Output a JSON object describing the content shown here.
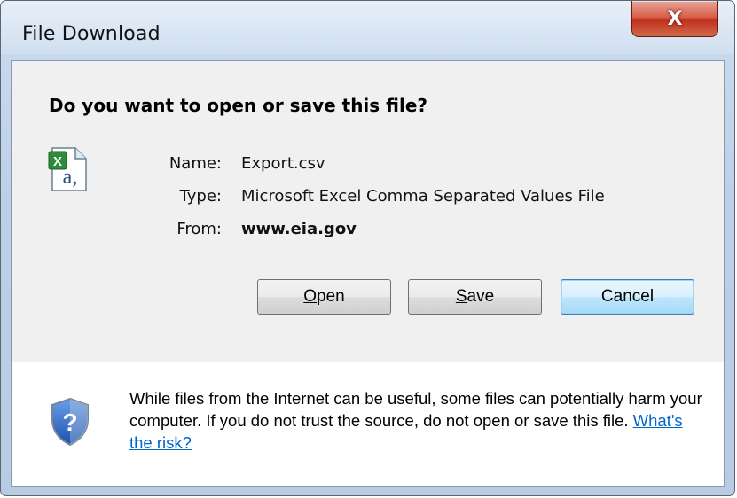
{
  "window": {
    "title": "File Download",
    "close_glyph": "X"
  },
  "dialog": {
    "question": "Do you want to open or save this file?",
    "file_icon": "excel-csv-file-icon",
    "name_label": "Name:",
    "name_value": "Export.csv",
    "type_label": "Type:",
    "type_value": "Microsoft Excel Comma Separated Values File",
    "from_label": "From:",
    "from_value": "www.eia.gov"
  },
  "buttons": {
    "open": {
      "mnemonic": "O",
      "rest": "pen"
    },
    "save": {
      "mnemonic": "S",
      "rest": "ave"
    },
    "cancel": "Cancel"
  },
  "footer": {
    "shield_icon": "security-shield-question-icon",
    "warning_text": "While files from the Internet can be useful, some files can potentially harm your computer. If you do not trust the source, do not open or save this file.",
    "risk_link": "What's the risk?"
  },
  "colors": {
    "link": "#0066cc",
    "close_button": "#c0321e",
    "default_button_border": "#3c7fb1"
  }
}
